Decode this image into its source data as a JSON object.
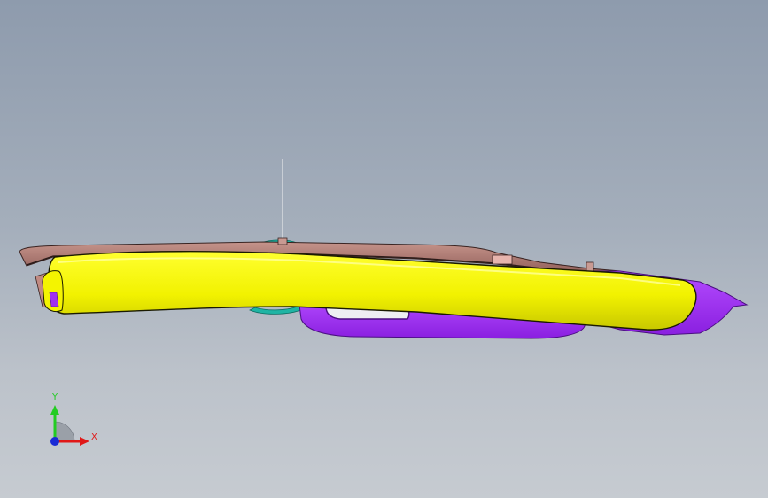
{
  "triad": {
    "y_label": "Y",
    "x_label": "X",
    "y_color": "#22cc22",
    "x_color": "#e01818",
    "z_color": "#1a2bd6"
  },
  "model": {
    "parts": [
      {
        "name": "top-housing",
        "color": "#b07a73"
      },
      {
        "name": "yellow-cover",
        "color": "#f0f000"
      },
      {
        "name": "purple-base",
        "color": "#a030f0"
      },
      {
        "name": "teal-ring",
        "color": "#1fb4a4"
      }
    ]
  }
}
